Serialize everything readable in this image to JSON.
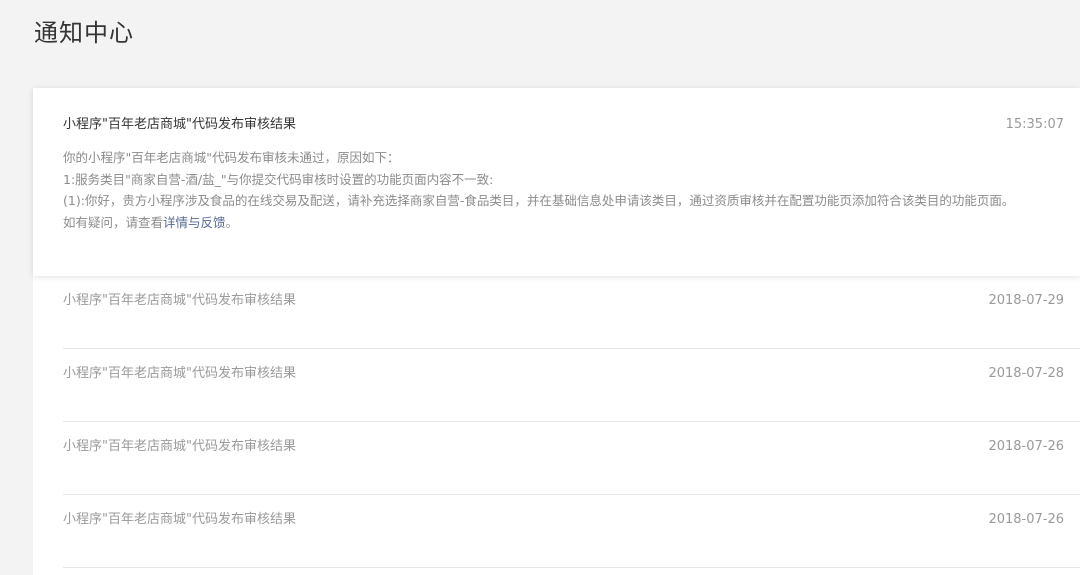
{
  "page_title": "通知中心",
  "expanded_notification": {
    "title": "小程序\"百年老店商城\"代码发布审核结果",
    "time": "15:35:07",
    "body_lines": [
      "你的小程序\"百年老店商城\"代码发布审核未通过，原因如下：",
      "1:服务类目\"商家自营-酒/盐_\"与你提交代码审核时设置的功能页面内容不一致:",
      "(1):你好，贵方小程序涉及食品的在线交易及配送，请补充选择商家自营-食品类目，并在基础信息处申请该类目，通过资质审核并在配置功能页添加符合该类目的功能页面。"
    ],
    "help_prefix": "如有疑问，请查看",
    "help_link": "详情与反馈",
    "help_suffix": "。"
  },
  "notifications": [
    {
      "title": "小程序\"百年老店商城\"代码发布审核结果",
      "date": "2018-07-29"
    },
    {
      "title": "小程序\"百年老店商城\"代码发布审核结果",
      "date": "2018-07-28"
    },
    {
      "title": "小程序\"百年老店商城\"代码发布审核结果",
      "date": "2018-07-26"
    },
    {
      "title": "小程序\"百年老店商城\"代码发布审核结果",
      "date": "2018-07-26"
    }
  ]
}
